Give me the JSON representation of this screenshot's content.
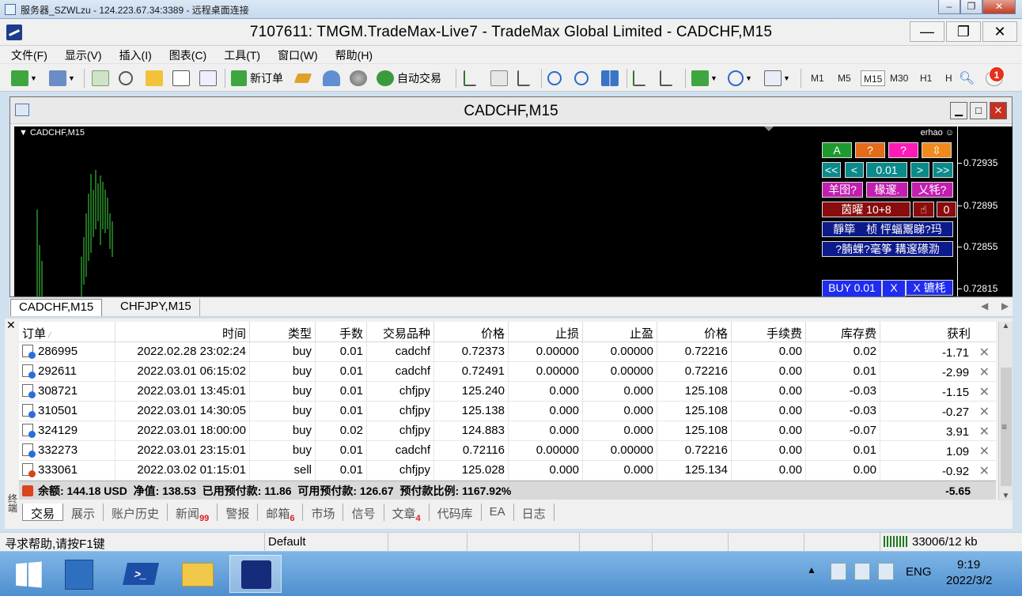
{
  "rdp": {
    "title": "服务器_SZWLzu - 124.223.67.34:3389 - 远程桌面连接"
  },
  "app": {
    "title": "7107611: TMGM.TradeMax-Live7 - TradeMax Global Limited - CADCHF,M15"
  },
  "menu": [
    "文件(F)",
    "显示(V)",
    "插入(I)",
    "图表(C)",
    "工具(T)",
    "窗口(W)",
    "帮助(H)"
  ],
  "toolbar": {
    "new_order": "新订单",
    "auto_trade": "自动交易",
    "timeframes": [
      "M1",
      "M5",
      "M15",
      "M30",
      "H1",
      "H"
    ],
    "active_timeframe": "M15",
    "notification_count": "1"
  },
  "chart_window": {
    "title": "CADCHF,M15",
    "symbol_label": "CADCHF,M15",
    "account_label": "erhao ☺",
    "price_labels": [
      "0.72935",
      "0.72895",
      "0.72855",
      "0.72815"
    ],
    "panel": {
      "row1": [
        "A",
        "?",
        "?",
        "⇳"
      ],
      "row2": [
        "<<",
        "<",
        "0.01",
        ">",
        ">>"
      ],
      "row3": [
        "羊囹?",
        "椽邃.",
        "乂牦?"
      ],
      "row4": [
        "茵曜 10+8",
        "☝",
        "0"
      ],
      "row5": "靜筚　桢 怦蝠鬻睇?玛",
      "row6": "?腩蜾?毫筝 耩邃礤泐",
      "buy": "BUY 0.01",
      "x": "X",
      "close": "X 镳枆"
    }
  },
  "chart_tabs": [
    "CADCHF,M15",
    "CHFJPY,M15"
  ],
  "terminal": {
    "columns": [
      "订单",
      "时间",
      "类型",
      "手数",
      "交易品种",
      "价格",
      "止损",
      "止盈",
      "价格",
      "手续费",
      "库存费",
      "获利"
    ],
    "rows": [
      [
        "286995",
        "2022.02.28 23:02:24",
        "buy",
        "0.01",
        "cadchf",
        "0.72373",
        "0.00000",
        "0.00000",
        "0.72216",
        "0.00",
        "0.02",
        "-1.71"
      ],
      [
        "292611",
        "2022.03.01 06:15:02",
        "buy",
        "0.01",
        "cadchf",
        "0.72491",
        "0.00000",
        "0.00000",
        "0.72216",
        "0.00",
        "0.01",
        "-2.99"
      ],
      [
        "308721",
        "2022.03.01 13:45:01",
        "buy",
        "0.01",
        "chfjpy",
        "125.240",
        "0.000",
        "0.000",
        "125.108",
        "0.00",
        "-0.03",
        "-1.15"
      ],
      [
        "310501",
        "2022.03.01 14:30:05",
        "buy",
        "0.01",
        "chfjpy",
        "125.138",
        "0.000",
        "0.000",
        "125.108",
        "0.00",
        "-0.03",
        "-0.27"
      ],
      [
        "324129",
        "2022.03.01 18:00:00",
        "buy",
        "0.02",
        "chfjpy",
        "124.883",
        "0.000",
        "0.000",
        "125.108",
        "0.00",
        "-0.07",
        "3.91"
      ],
      [
        "332273",
        "2022.03.01 23:15:01",
        "buy",
        "0.01",
        "cadchf",
        "0.72116",
        "0.00000",
        "0.00000",
        "0.72216",
        "0.00",
        "0.01",
        "1.09"
      ],
      [
        "333061",
        "2022.03.02 01:15:01",
        "sell",
        "0.01",
        "chfjpy",
        "125.028",
        "0.000",
        "0.000",
        "125.134",
        "0.00",
        "0.00",
        "-0.92"
      ]
    ],
    "summary": "余额: 144.18 USD  净值: 138.53  已用预付款: 11.86  可用预付款: 126.67  预付款比例: 1167.92%",
    "summary_profit": "-5.65",
    "side_label": "终端",
    "tabs": [
      "交易",
      "展示",
      "账户历史",
      "新闻",
      "警报",
      "邮箱",
      "市场",
      "信号",
      "文章",
      "代码库",
      "EA",
      "日志"
    ],
    "tab_badges": {
      "news": "99",
      "mail": "6",
      "articles": "4"
    }
  },
  "status": {
    "help": "寻求帮助,请按F1键",
    "profile": "Default",
    "traffic": "33006/12 kb"
  },
  "taskbar": {
    "lang": "ENG",
    "time": "9:19",
    "date": "2022/3/2"
  }
}
